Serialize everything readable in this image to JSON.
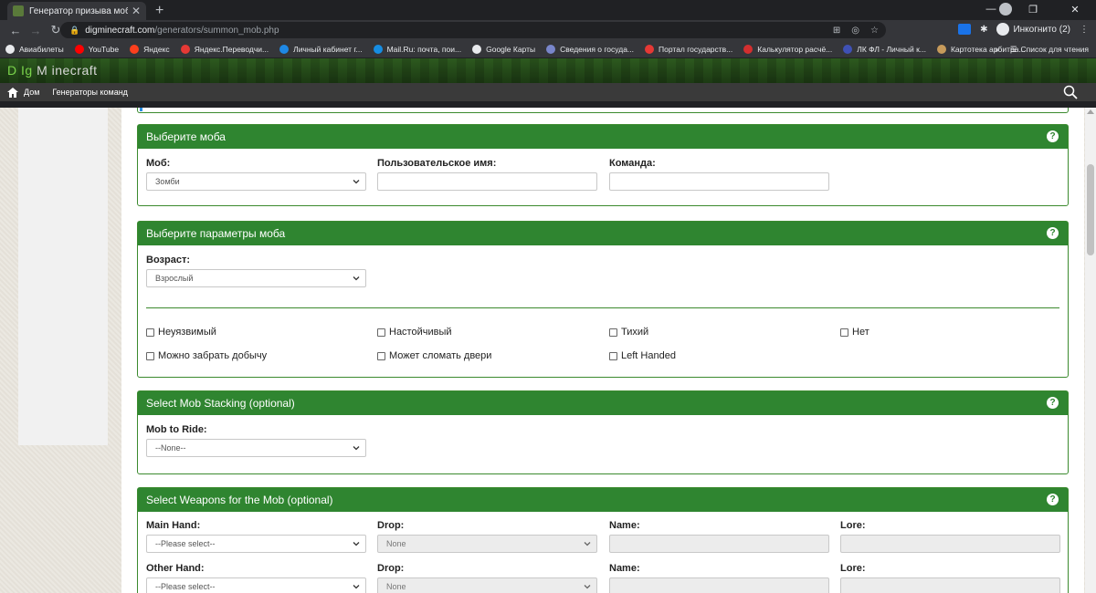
{
  "browser": {
    "tab_title": "Генератор призыва мобов (Java",
    "url_host": "digminecraft.com",
    "url_path": "/generators/summon_mob.php",
    "profile_label": "Инкогнито (2)",
    "bookmarks": [
      {
        "label": "Авиабилеты",
        "color": "#e8eaed"
      },
      {
        "label": "YouTube",
        "color": "#ff0000"
      },
      {
        "label": "Яндекс",
        "color": "#fc3f1d"
      },
      {
        "label": "Яндекс.Переводчи...",
        "color": "#e53935"
      },
      {
        "label": "Личный кабинет г...",
        "color": "#1e88e5"
      },
      {
        "label": "Mail.Ru: почта, пои...",
        "color": "#168de2"
      },
      {
        "label": "Google Карты",
        "color": "#e8eaed"
      },
      {
        "label": "Сведения о госуда...",
        "color": "#7986cb"
      },
      {
        "label": "Портал государств...",
        "color": "#e53935"
      },
      {
        "label": "Калькулятор расчё...",
        "color": "#d32f2f"
      },
      {
        "label": "ЛК ФЛ - Личный к...",
        "color": "#3f51b5"
      },
      {
        "label": "Картотека арбитра...",
        "color": "#c79b5b"
      }
    ],
    "bookmarks_more": "»",
    "reading_list": "Список для чтения"
  },
  "site": {
    "logo_dig": "D Ig",
    "logo_rest": " M inecraft",
    "nav_home": "Дом",
    "nav_generators": "Генераторы команд"
  },
  "sections": {
    "mob": {
      "title": "Выберите моба",
      "mob_label": "Моб:",
      "mob_value": "Зомби",
      "name_label": "Пользовательское имя:",
      "command_label": "Команда:"
    },
    "params": {
      "title": "Выберите параметры моба",
      "age_label": "Возраст:",
      "age_value": "Взрослый",
      "checks": [
        "Неуязвимый",
        "Настойчивый",
        "Тихий",
        "Нет",
        "Можно забрать добычу",
        "Может сломать двери",
        "Left Handed"
      ]
    },
    "stacking": {
      "title": "Select Mob Stacking (optional)",
      "ride_label": "Mob to Ride:",
      "ride_value": "--None--"
    },
    "weapons": {
      "title": "Select Weapons for the Mob (optional)",
      "main_label": "Main Hand:",
      "other_label": "Other Hand:",
      "drop_label": "Drop:",
      "name_label": "Name:",
      "lore_label": "Lore:",
      "hand_value": "--Please select--",
      "drop_value": "None"
    }
  },
  "help_glyph": "?"
}
